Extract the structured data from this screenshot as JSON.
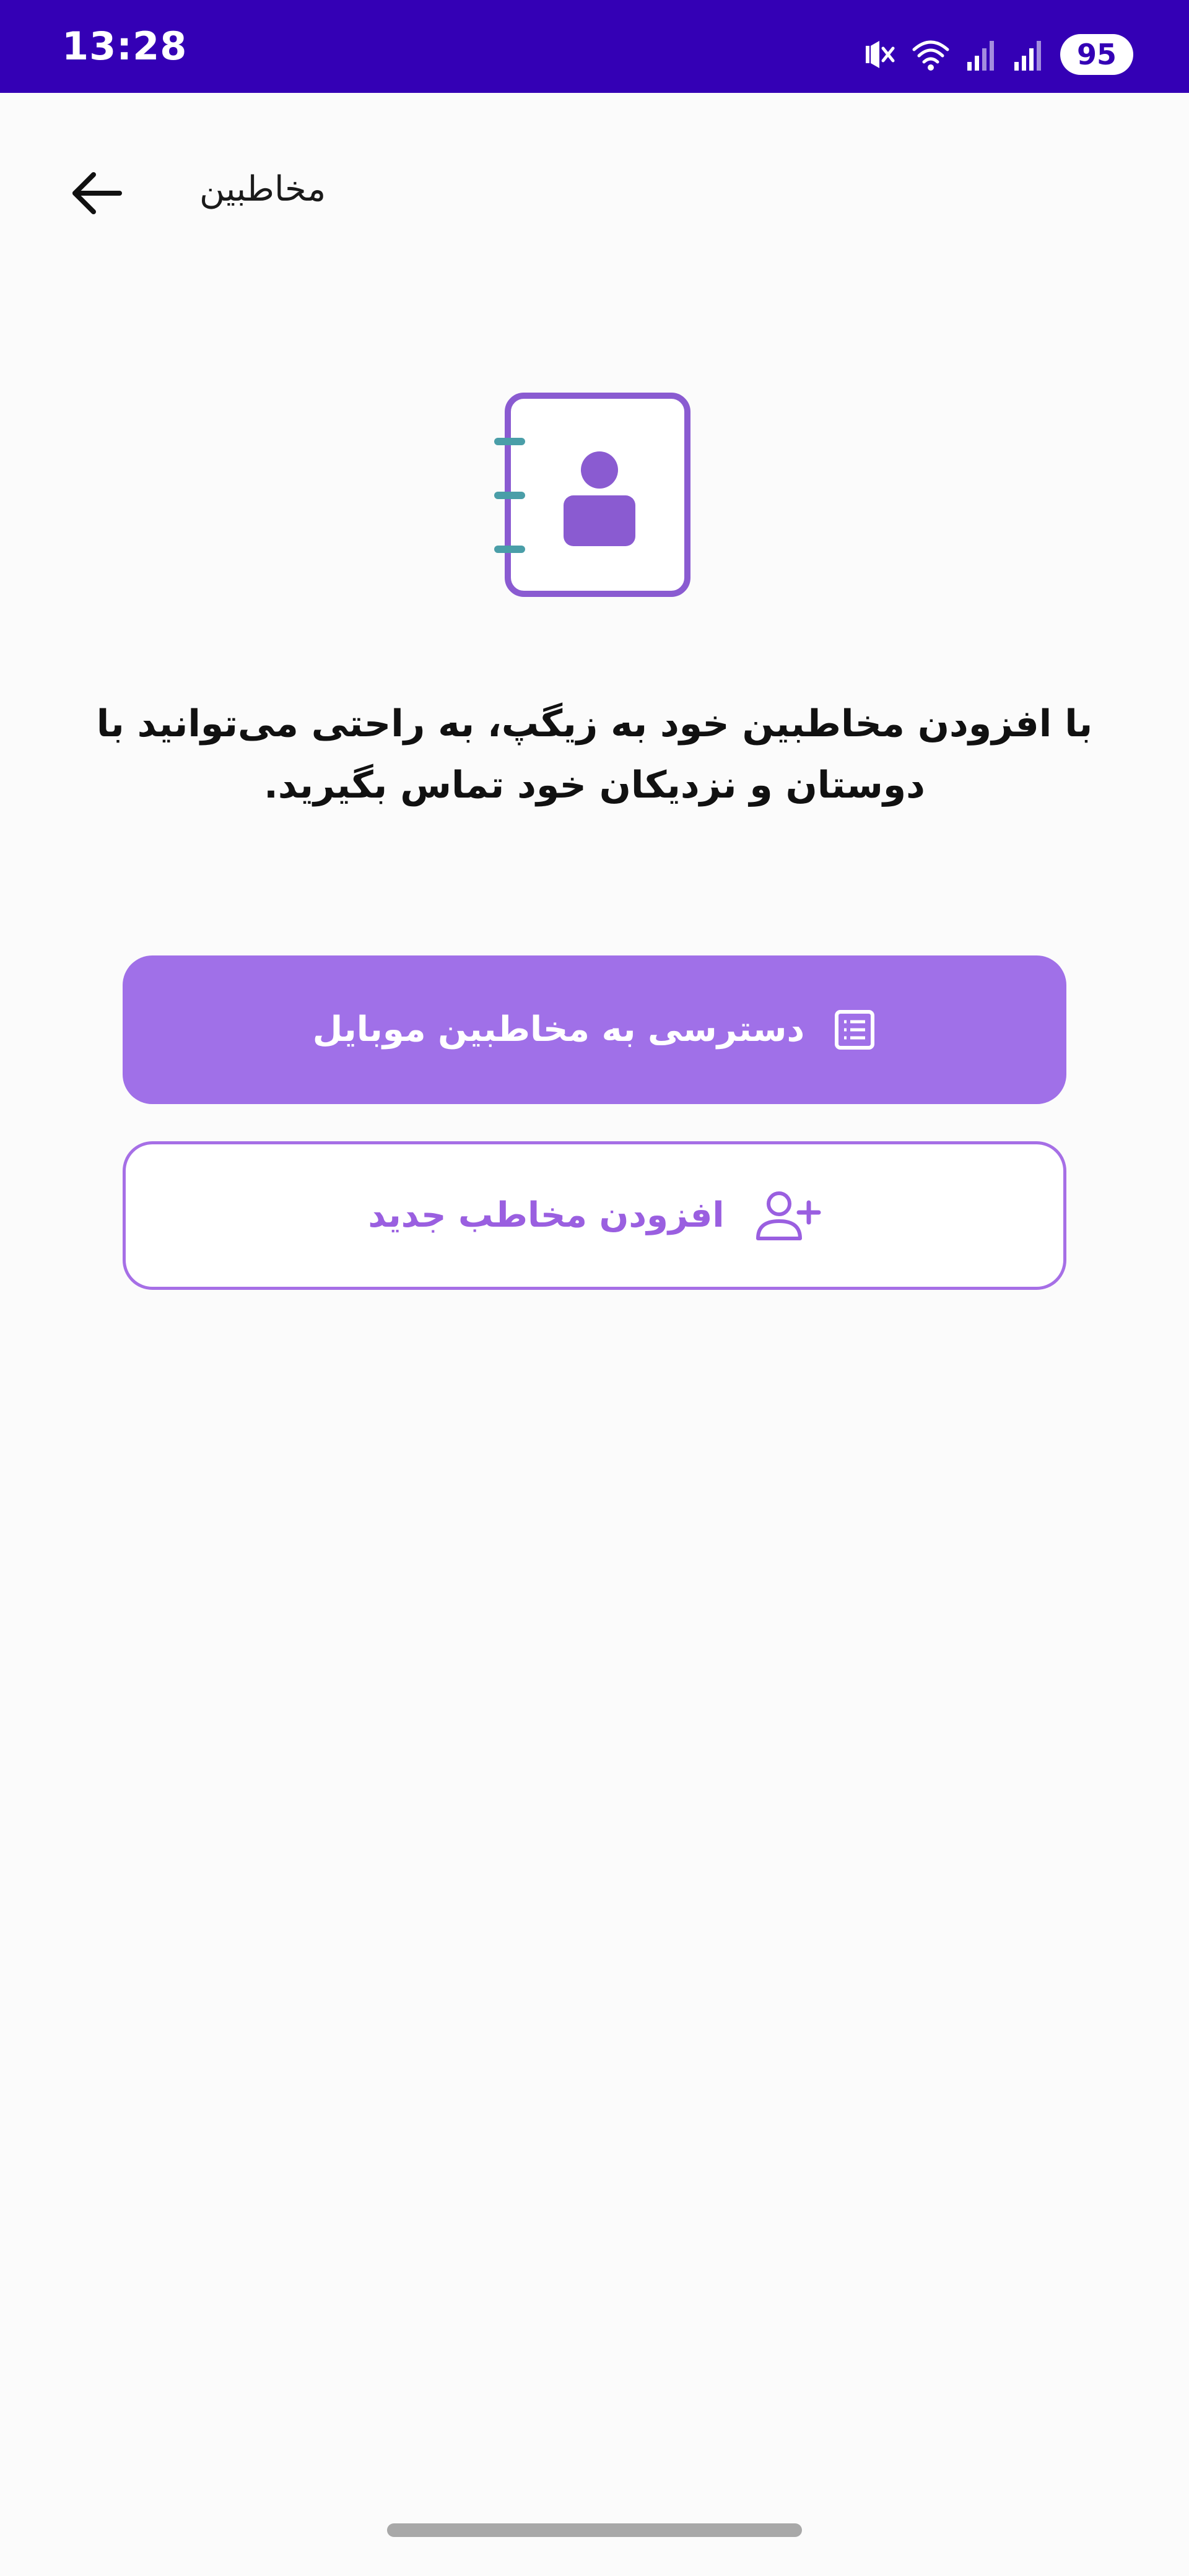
{
  "status_bar": {
    "time": "13:28",
    "battery": "95",
    "icons": [
      "mute-vibrate-icon",
      "wifi-icon",
      "signal-icon",
      "signal-icon"
    ],
    "background": "#3400b5"
  },
  "header": {
    "title": "مخاطبین",
    "back_icon": "arrow-left-icon"
  },
  "illustration": {
    "icon": "contacts-book-icon",
    "stroke_color": "#8a5bd1",
    "ring_color": "#4a9ea8"
  },
  "description": "با افزودن مخاطبین خود به زیگپ، به راحتی می‌توانید با دوستان و نزدیکان خود تماس بگیرید.",
  "buttons": {
    "access_contacts": {
      "label": "دسترسی به مخاطبین موبایل",
      "icon": "contact-list-icon",
      "background": "#a070e8"
    },
    "add_contact": {
      "label": "افزودن مخاطب جدید",
      "icon": "add-user-icon",
      "accent": "#9a5fe0"
    }
  }
}
